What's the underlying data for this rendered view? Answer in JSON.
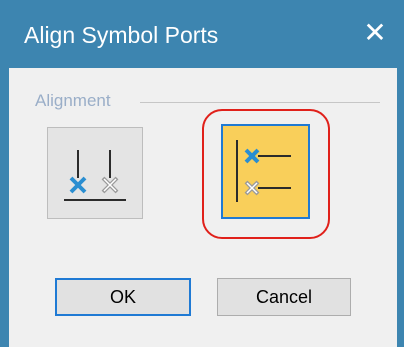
{
  "window": {
    "title": "Align Symbol Ports",
    "close_glyph": "✕"
  },
  "group": {
    "label": "Alignment"
  },
  "options": [
    {
      "icon": "align-bottom-icon",
      "selected": false
    },
    {
      "icon": "align-left-icon",
      "selected": true
    }
  ],
  "buttons": {
    "ok": "OK",
    "cancel": "Cancel"
  },
  "colors": {
    "titlebar": "#3d85b0",
    "selected_fill": "#f9cf5a",
    "selection_border": "#1f7ad4",
    "annotation_ring": "#e0201a",
    "port_blue": "#2a8ed1"
  }
}
